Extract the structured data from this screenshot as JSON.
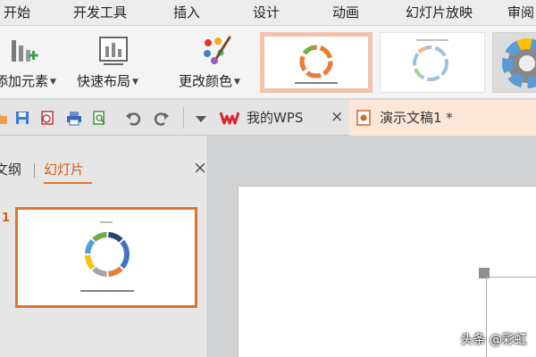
{
  "menu": {
    "items": [
      "开始",
      "开发工具",
      "插入",
      "设计",
      "动画",
      "幻灯片放映",
      "审阅"
    ]
  },
  "ribbon": {
    "add_element_label": "添加元素",
    "quick_layout_label": "快速布局",
    "change_color_label": "更改颜色",
    "dropdown_glyph": "▼"
  },
  "tabs": {
    "my_wps_label": "我的WPS",
    "document_label": "演示文稿1 *",
    "close_glyph": "×"
  },
  "left_pane": {
    "outline_tab": "文纲",
    "slides_tab": "幻灯片",
    "close_glyph": "×",
    "slide_number": "1"
  },
  "watermark": "头条 @彩虹",
  "colors": {
    "accent_orange": "#e0732e",
    "selected_thumb_border": "#f2c2ad",
    "wps_red": "#d7252b"
  }
}
